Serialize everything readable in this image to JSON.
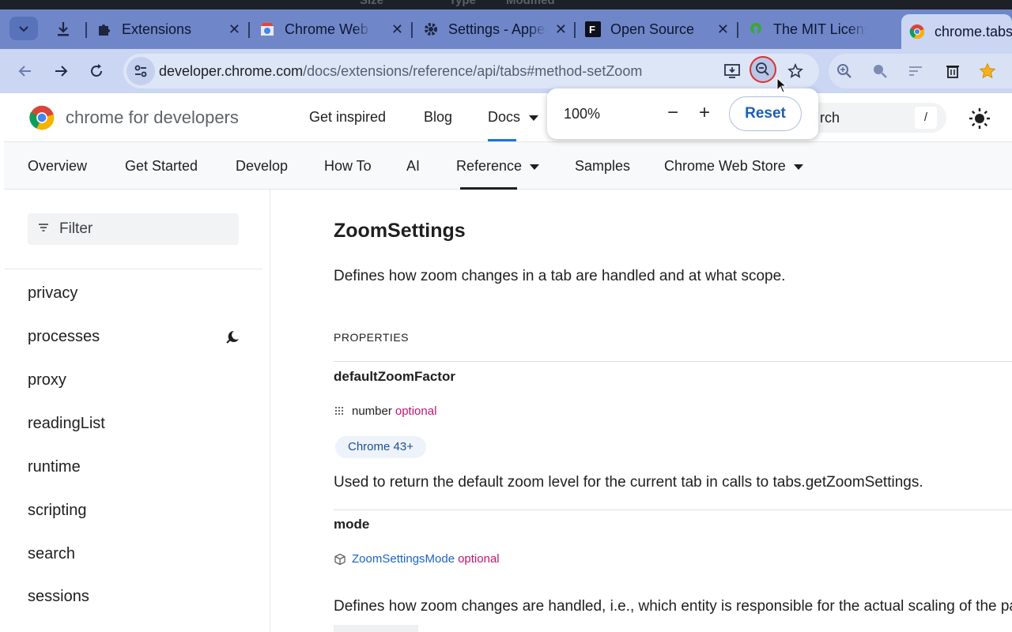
{
  "browser": {
    "top_strip": [
      "Size",
      "Type",
      "Modified"
    ],
    "tabs": [
      {
        "title": "Extensions",
        "icon": "puzzle-icon"
      },
      {
        "title": "Chrome Web Store",
        "icon": "chrome-web-store-icon"
      },
      {
        "title": "Settings - Appearance",
        "icon": "gear-icon"
      },
      {
        "title": "Open Source",
        "icon": "f-logo-icon"
      },
      {
        "title": "The MIT License",
        "icon": "osi-logo-icon"
      },
      {
        "title": "chrome.tabs",
        "icon": "chrome-icon"
      }
    ],
    "url_host": "developer.chrome.com",
    "url_path": "/docs/extensions/reference/api/tabs#method-setZoom"
  },
  "zoom_popup": {
    "level": "100%",
    "minus": "−",
    "plus": "+",
    "reset_label": "Reset"
  },
  "site": {
    "brand": "chrome for developers",
    "nav": [
      "Get inspired",
      "Blog",
      "Docs"
    ],
    "search_label": "rch",
    "search_shortcut": "/",
    "subnav": [
      "Overview",
      "Get Started",
      "Develop",
      "How To",
      "AI",
      "Reference",
      "Samples",
      "Chrome Web Store"
    ]
  },
  "sidebar": {
    "filter_label": "Filter",
    "items": [
      "privacy",
      "processes",
      "proxy",
      "readingList",
      "runtime",
      "scripting",
      "search",
      "sessions"
    ]
  },
  "main": {
    "heading": "ZoomSettings",
    "description": "Defines how zoom changes in a tab are handled and at what scope.",
    "properties_label": "PROPERTIES",
    "prop1": {
      "name": "defaultZoomFactor",
      "type": "number",
      "optional": "optional",
      "chip": "Chrome 43+",
      "text": "Used to return the default zoom level for the current tab in calls to tabs.getZoomSettings."
    },
    "prop2": {
      "name": "mode",
      "type": "ZoomSettingsMode",
      "optional": "optional",
      "text": "Defines how zoom changes are handled, i.e., which entity is responsible for the actual scaling of the page;"
    }
  }
}
